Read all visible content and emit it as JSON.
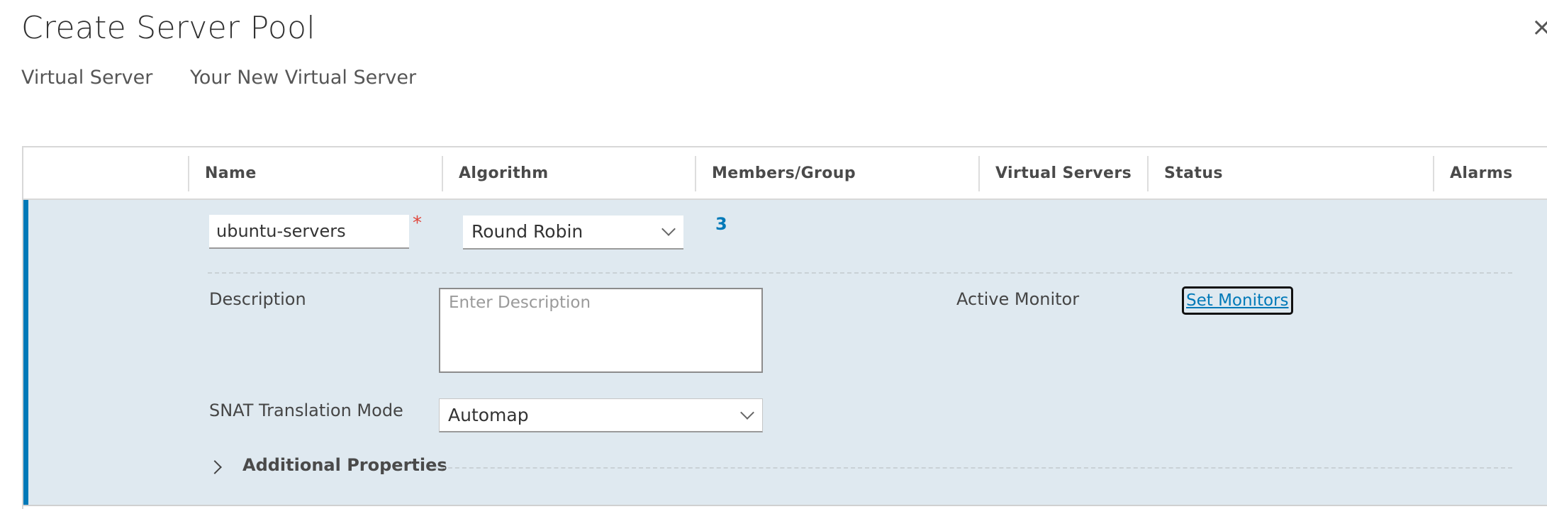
{
  "dialog": {
    "title": "Create Server Pool",
    "close_glyph": "×"
  },
  "context": {
    "label": "Virtual Server",
    "value": "Your New Virtual Server"
  },
  "table": {
    "columns": [
      "Name",
      "Algorithm",
      "Members/Group",
      "Virtual Servers",
      "Status",
      "Alarms"
    ]
  },
  "row": {
    "name_value": "ubuntu-servers",
    "required_marker": "*",
    "algorithm": "Round Robin",
    "members_count": "3",
    "description_label": "Description",
    "description_placeholder": "Enter Description",
    "description_value": "",
    "active_monitor_label": "Active Monitor",
    "set_monitors_label": "Set Monitors",
    "snat_label": "SNAT Translation Mode",
    "snat_value": "Automap",
    "additional_properties_label": "Additional Properties"
  },
  "colors": {
    "accent": "#0079b8",
    "row_background": "#dfe9f0",
    "required": "#e0453a"
  }
}
